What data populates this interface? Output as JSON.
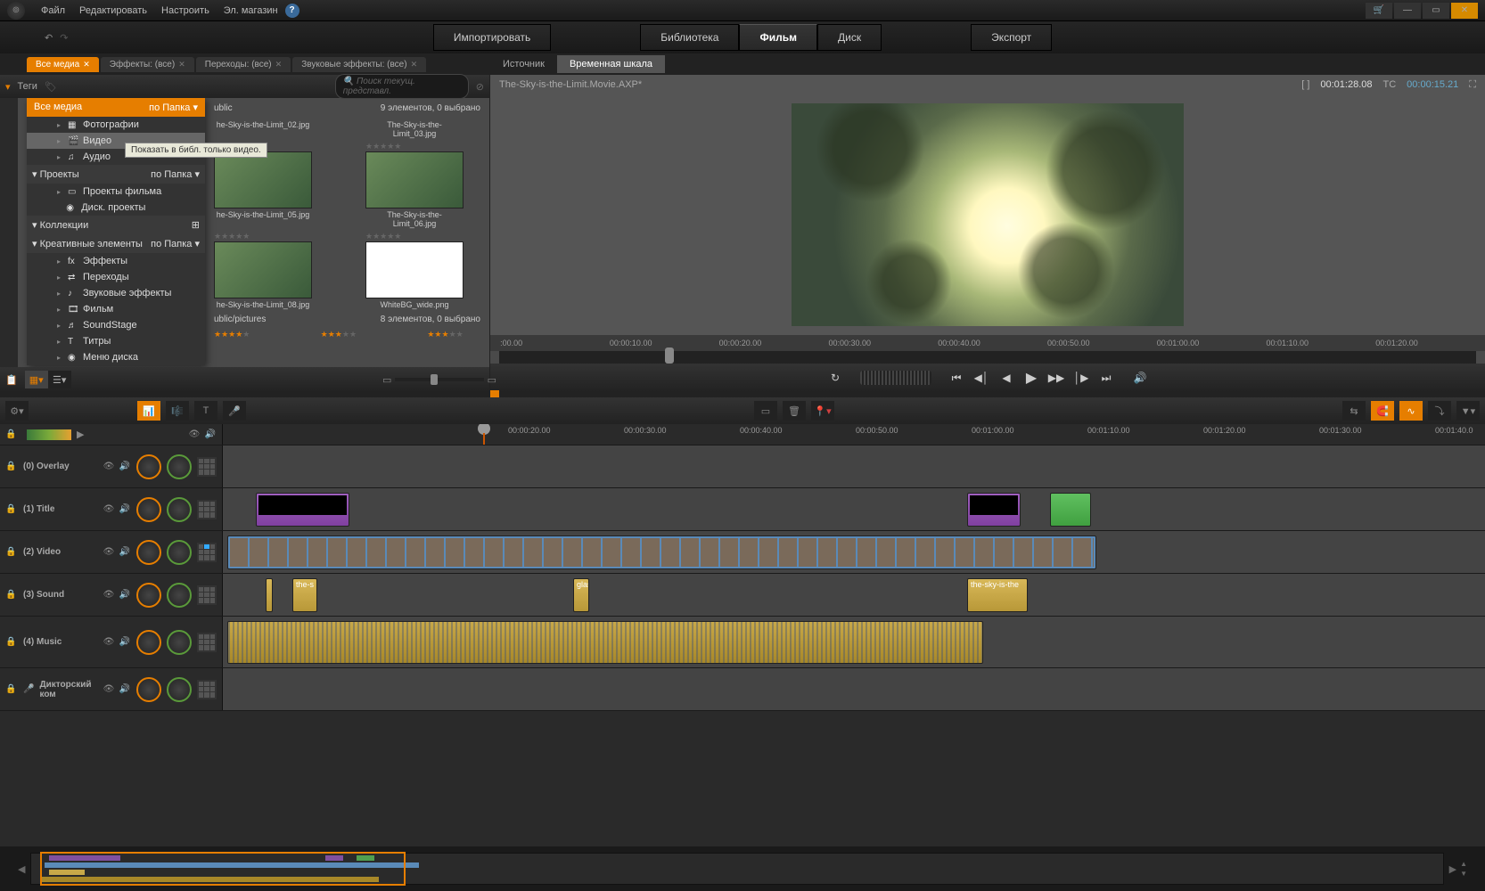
{
  "menu": {
    "file": "Файл",
    "edit": "Редактировать",
    "setup": "Настроить",
    "store": "Эл. магазин"
  },
  "modes": {
    "import": "Импортировать",
    "library": "Библиотека",
    "movie": "Фильм",
    "disc": "Диск",
    "export": "Экспорт"
  },
  "library": {
    "tabs": {
      "all_media": "Все медиа",
      "effects": "Эффекты: (все)",
      "transitions": "Переходы: (все)",
      "sound_fx": "Звуковые эффекты: (все)"
    },
    "tags_label": "Теги",
    "search_placeholder": "Поиск текущ. представл.",
    "tree": {
      "all_media": "Все медиа",
      "by_folder": "по Папка",
      "photos": "Фотографии",
      "video": "Видео",
      "audio": "Аудио",
      "projects": "Проекты",
      "movie_projects": "Проекты фильма",
      "disc_projects": "Диск. проекты",
      "collections": "Коллекции",
      "creative": "Креативные элементы",
      "effects": "Эффекты",
      "transitions": "Переходы",
      "sound_effects": "Звуковые эффекты",
      "movie": "Фильм",
      "soundstage": "SoundStage",
      "titles": "Титры",
      "disc_menu": "Меню диска"
    },
    "tooltip": "Показать в библ. только видео.",
    "group_path": "ublic",
    "group_info": "9 элементов, 0 выбрано",
    "group_path2": "ublic/pictures",
    "group_info2": "8 элементов, 0 выбрано",
    "thumbs": {
      "t02": "he-Sky-is-the-Limit_02.jpg",
      "t03": "The-Sky-is-the-Limit_03.jpg",
      "t05": "he-Sky-is-the-Limit_05.jpg",
      "t06": "The-Sky-is-the-Limit_06.jpg",
      "t08": "he-Sky-is-the-Limit_08.jpg",
      "twhite": "WhiteBG_wide.png"
    }
  },
  "preview": {
    "source_tab": "Источник",
    "timeline_tab": "Временная шкала",
    "project_name": "The-Sky-is-the-Limit.Movie.AXP*",
    "tc1_label": "[ ]",
    "tc1": "00:01:28.08",
    "tc2_label": "TC",
    "tc2": "00:00:15.21",
    "ruler": [
      ":00.00",
      "00:00:10.00",
      "00:00:20.00",
      "00:00:30.00",
      "00:00:40.00",
      "00:00:50.00",
      "00:01:00.00",
      "00:01:10.00",
      "00:01:20.00"
    ]
  },
  "timeline": {
    "ruler": [
      "00:00:20.00",
      "00:00:30.00",
      "00:00:40.00",
      "00:00:50.00",
      "00:01:00.00",
      "00:01:10.00",
      "00:01:20.00",
      "00:01:30.00",
      "00:01:40.0"
    ],
    "tracks": {
      "overlay": "(0) Overlay",
      "title": "(1) Title",
      "video": "(2) Video",
      "sound": "(3) Sound",
      "music": "(4) Music",
      "narration": "Дикторский ком"
    },
    "clips": {
      "sound1": "the-s",
      "sound2": "glas",
      "sound3": "the-sky-is-the"
    }
  }
}
